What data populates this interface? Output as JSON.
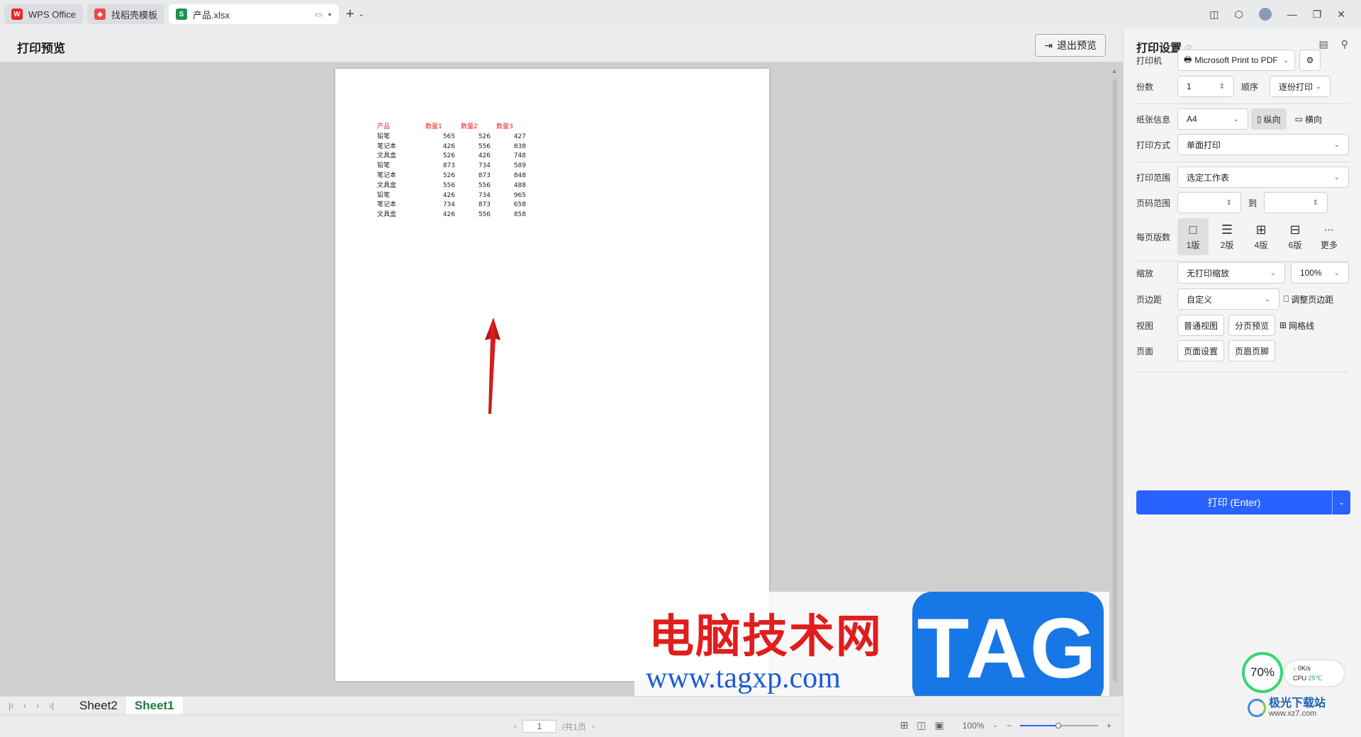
{
  "titlebar": {
    "tabs": [
      {
        "label": "WPS Office",
        "icon": "wps-logo-icon"
      },
      {
        "label": "找稻壳模板",
        "icon": "docer-icon"
      },
      {
        "label": "产品.xlsx",
        "icon": "spreadsheet-icon"
      }
    ]
  },
  "preview": {
    "title": "打印预览",
    "exit_label": "退出预览"
  },
  "sheet": {
    "headers": [
      "产品",
      "数量1",
      "数量2",
      "数量3"
    ],
    "rows": [
      [
        "铅笔",
        "565",
        "526",
        "427"
      ],
      [
        "笔记本",
        "426",
        "556",
        "838"
      ],
      [
        "文具盒",
        "526",
        "426",
        "748"
      ],
      [
        "铅笔",
        "873",
        "734",
        "589"
      ],
      [
        "笔记本",
        "526",
        "873",
        "848"
      ],
      [
        "文具盒",
        "556",
        "556",
        "488"
      ],
      [
        "铅笔",
        "426",
        "734",
        "965"
      ],
      [
        "笔记本",
        "734",
        "873",
        "658"
      ],
      [
        "文具盒",
        "426",
        "556",
        "858"
      ]
    ],
    "header_color": "#e41e1e"
  },
  "sheetbar": {
    "tabs": [
      "Sheet2",
      "Sheet1"
    ],
    "active": "Sheet1"
  },
  "statusbar": {
    "page_input": "1",
    "page_total": "/共1页",
    "zoom": "100%"
  },
  "panel": {
    "title": "打印设置",
    "printer_label": "打印机",
    "printer_value": "Microsoft Print to PDF",
    "copies_label": "份数",
    "copies_value": "1",
    "order_label": "顺序",
    "order_value": "逐份打印",
    "paper_label": "纸张信息",
    "paper_value": "A4",
    "portrait_label": "纵向",
    "landscape_label": "横向",
    "mode_label": "打印方式",
    "mode_value": "单面打印",
    "range_label": "打印范围",
    "range_value": "选定工作表",
    "pagerange_label": "页码范围",
    "to_label": "到",
    "pps_label": "每页版数",
    "pps_options": [
      "1版",
      "2版",
      "4版",
      "6版",
      "更多"
    ],
    "scale_label": "缩放",
    "scale_value": "无打印缩放",
    "scale_pct": "100%",
    "margin_label": "页边距",
    "margin_value": "自定义",
    "adjust_margin": "调整页边距",
    "view_label": "视图",
    "view_normal": "普通视图",
    "view_pagebreak": "分页预览",
    "gridlines": "网格线",
    "page_label": "页面",
    "page_setup": "页面设置",
    "header_footer": "页眉页脚",
    "print_button": "打印 (Enter)",
    "accent": "#2962ff"
  },
  "watermark": {
    "cn": "电脑技术网",
    "url": "www.tagxp.com",
    "tag": "TAG"
  },
  "cpu_widget": {
    "percent": "70%",
    "net": "0K/s",
    "cpu": "CPU",
    "temp": "25℃"
  },
  "xz": {
    "name": "极光下载站",
    "url": "www.xz7.com"
  }
}
